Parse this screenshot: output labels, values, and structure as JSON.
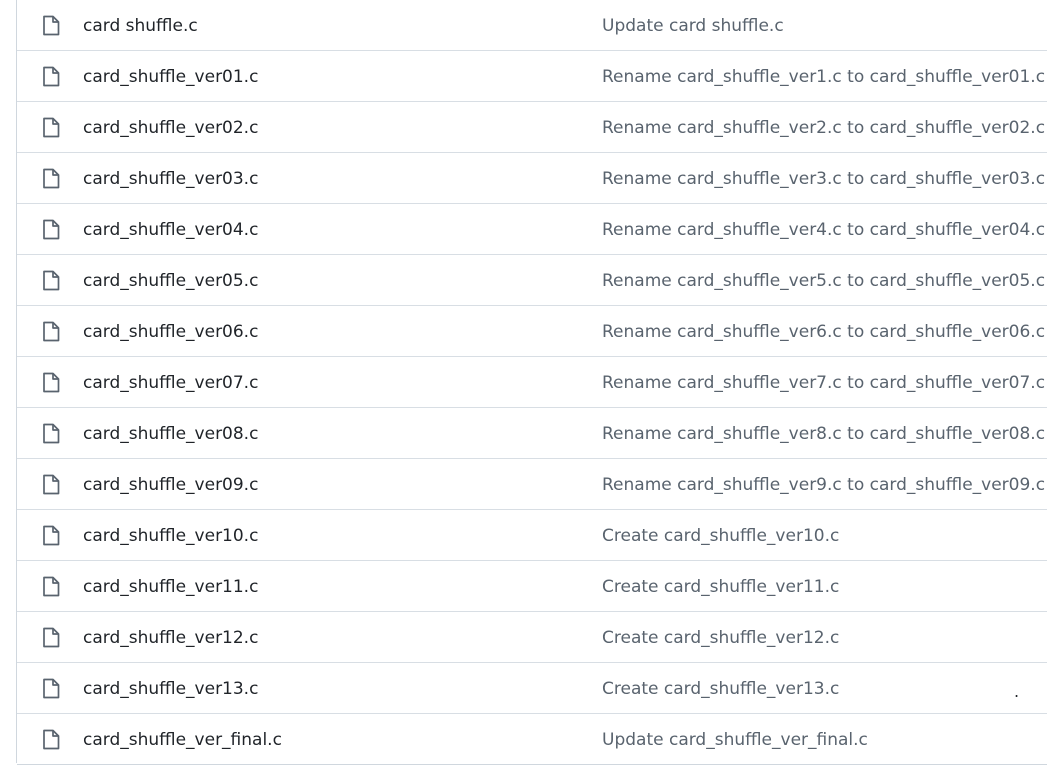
{
  "files": [
    {
      "name": "card shuffle.c",
      "commit": "Update card shuffle.c"
    },
    {
      "name": "card_shuffle_ver01.c",
      "commit": "Rename card_shuffle_ver1.c to card_shuffle_ver01.c"
    },
    {
      "name": "card_shuffle_ver02.c",
      "commit": "Rename card_shuffle_ver2.c to card_shuffle_ver02.c"
    },
    {
      "name": "card_shuffle_ver03.c",
      "commit": "Rename card_shuffle_ver3.c to card_shuffle_ver03.c"
    },
    {
      "name": "card_shuffle_ver04.c",
      "commit": "Rename card_shuffle_ver4.c to card_shuffle_ver04.c"
    },
    {
      "name": "card_shuffle_ver05.c",
      "commit": "Rename card_shuffle_ver5.c to card_shuffle_ver05.c"
    },
    {
      "name": "card_shuffle_ver06.c",
      "commit": "Rename card_shuffle_ver6.c to card_shuffle_ver06.c"
    },
    {
      "name": "card_shuffle_ver07.c",
      "commit": "Rename card_shuffle_ver7.c to card_shuffle_ver07.c"
    },
    {
      "name": "card_shuffle_ver08.c",
      "commit": "Rename card_shuffle_ver8.c to card_shuffle_ver08.c"
    },
    {
      "name": "card_shuffle_ver09.c",
      "commit": "Rename card_shuffle_ver9.c to card_shuffle_ver09.c"
    },
    {
      "name": "card_shuffle_ver10.c",
      "commit": "Create card_shuffle_ver10.c"
    },
    {
      "name": "card_shuffle_ver11.c",
      "commit": "Create card_shuffle_ver11.c"
    },
    {
      "name": "card_shuffle_ver12.c",
      "commit": "Create card_shuffle_ver12.c"
    },
    {
      "name": "card_shuffle_ver13.c",
      "commit": "Create card_shuffle_ver13.c"
    },
    {
      "name": "card_shuffle_ver_final.c",
      "commit": "Update card_shuffle_ver_final.c"
    }
  ],
  "stray_mark": ".",
  "icons": {
    "file": "file-icon"
  },
  "colors": {
    "filename_text": "#1f2328",
    "commit_text": "#59636e",
    "row_border": "#d8dee4",
    "icon_stroke": "#59636e"
  }
}
